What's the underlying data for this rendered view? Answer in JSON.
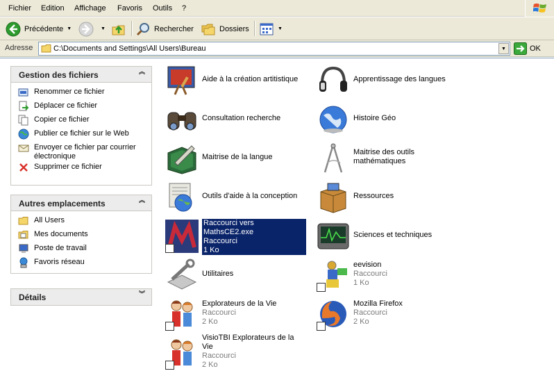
{
  "menu": {
    "items": [
      "Fichier",
      "Edition",
      "Affichage",
      "Favoris",
      "Outils",
      "?"
    ]
  },
  "toolbar": {
    "back_label": "Précédente",
    "search_label": "Rechercher",
    "folders_label": "Dossiers"
  },
  "address": {
    "label": "Adresse",
    "path": "C:\\Documents and Settings\\All Users\\Bureau",
    "go_label": "OK"
  },
  "tasks": {
    "file_panel": {
      "title": "Gestion des fichiers",
      "items": [
        {
          "label": "Renommer ce fichier",
          "icon": "rename-icon"
        },
        {
          "label": "Déplacer ce fichier",
          "icon": "move-icon"
        },
        {
          "label": "Copier ce fichier",
          "icon": "copy-icon"
        },
        {
          "label": "Publier ce fichier sur le Web",
          "icon": "publish-web-icon"
        },
        {
          "label": "Envoyer ce fichier par courrier électronique",
          "icon": "email-icon"
        },
        {
          "label": "Supprimer ce fichier",
          "icon": "delete-icon"
        }
      ]
    },
    "places_panel": {
      "title": "Autres emplacements",
      "items": [
        {
          "label": "All Users",
          "icon": "folder-icon"
        },
        {
          "label": "Mes documents",
          "icon": "my-documents-icon"
        },
        {
          "label": "Poste de travail",
          "icon": "my-computer-icon"
        },
        {
          "label": "Favoris réseau",
          "icon": "network-icon"
        }
      ]
    },
    "details_panel": {
      "title": "Détails"
    }
  },
  "files": [
    {
      "name": "Aide à la création artitistique",
      "icon": "art-easel-icon"
    },
    {
      "name": "Apprentissage des langues",
      "icon": "headphones-icon"
    },
    {
      "name": "Consultation recherche",
      "icon": "binoculars-icon"
    },
    {
      "name": "Histoire Géo",
      "icon": "globe-icon"
    },
    {
      "name": "Maitrise de la langue",
      "icon": "book-pen-icon"
    },
    {
      "name": "Maitrise des outils mathématiques",
      "icon": "compass-icon"
    },
    {
      "name": "Outils d'aide à la conception",
      "icon": "newspaper-globe-icon"
    },
    {
      "name": "Ressources",
      "icon": "box-icon"
    },
    {
      "name": "Raccourci vers MathsCE2.exe",
      "type": "Raccourci",
      "size": "1 Ko",
      "icon": "mathsce2-icon",
      "selected": true
    },
    {
      "name": "Sciences et techniques",
      "icon": "oscilloscope-icon"
    },
    {
      "name": "Utilitaires",
      "icon": "wrench-icon"
    },
    {
      "name": "eevision",
      "type": "Raccourci",
      "size": "1 Ko",
      "icon": "eevision-icon"
    },
    {
      "name": "Explorateurs de la Vie",
      "type": "Raccourci",
      "size": "2 Ko",
      "icon": "kids-icon"
    },
    {
      "name": "Mozilla Firefox",
      "type": "Raccourci",
      "size": "2 Ko",
      "icon": "firefox-icon"
    },
    {
      "name": "VisioTBI Explorateurs de la Vie",
      "type": "Raccourci",
      "size": "2 Ko",
      "icon": "kids-icon"
    }
  ],
  "colors": {
    "chrome": "#ece9d8",
    "selection": "#0a246a",
    "panel_header": "#ececec"
  }
}
